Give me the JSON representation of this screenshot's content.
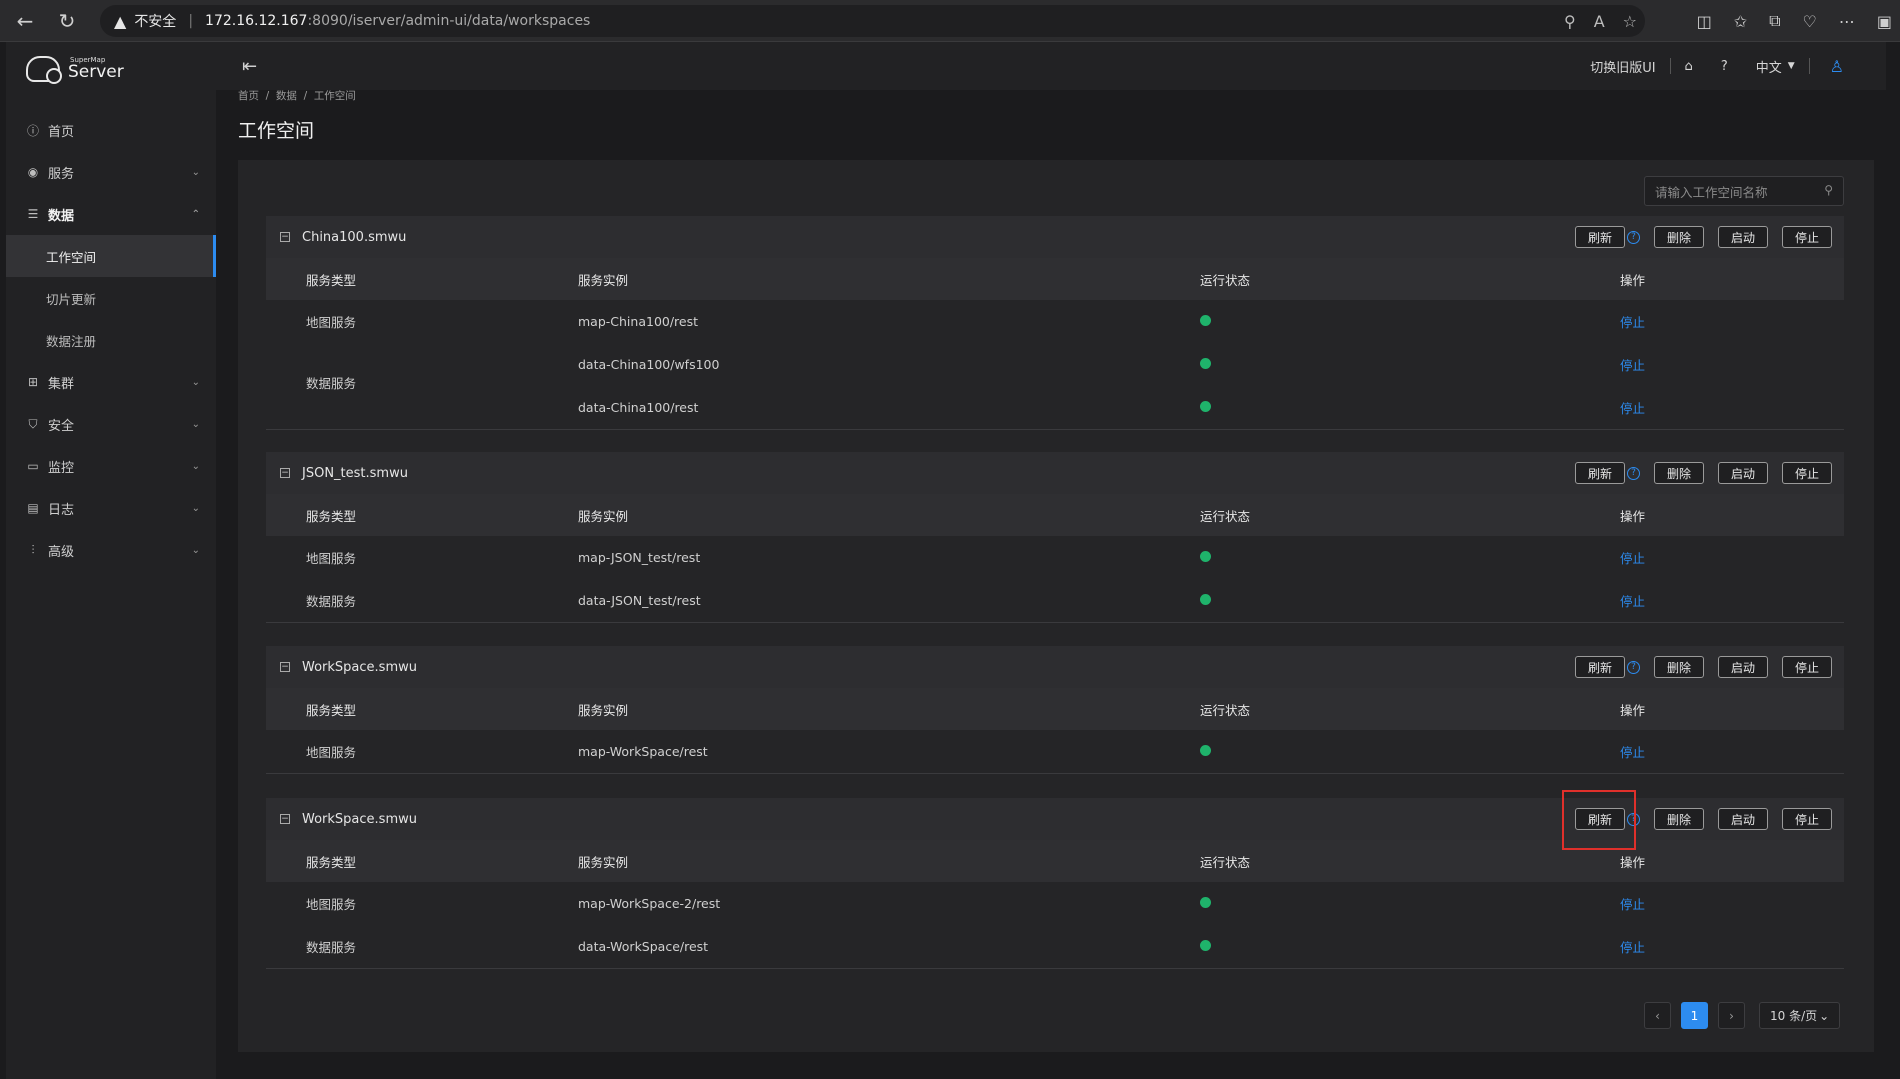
{
  "browser": {
    "not_secure": "不安全",
    "url_host": "172.16.12.167",
    "url_path": ":8090/iserver/admin-ui/data/workspaces"
  },
  "logo": {
    "small": "SuperMap",
    "big": "Server"
  },
  "sidebar": {
    "items": [
      {
        "label": "首页",
        "icon": "info-icon"
      },
      {
        "label": "服务",
        "icon": "eye-icon"
      },
      {
        "label": "数据",
        "icon": "database-icon"
      },
      {
        "label": "集群",
        "icon": "cluster-icon"
      },
      {
        "label": "安全",
        "icon": "shield-icon"
      },
      {
        "label": "监控",
        "icon": "monitor-icon"
      },
      {
        "label": "日志",
        "icon": "log-icon"
      },
      {
        "label": "高级",
        "icon": "sliders-icon"
      }
    ],
    "sub_items": [
      "工作空间",
      "切片更新",
      "数据注册"
    ]
  },
  "header": {
    "switch_ui": "切换旧版UI",
    "lang": "中文"
  },
  "breadcrumb": {
    "home": "首页",
    "data": "数据",
    "current": "工作空间"
  },
  "page_title": "工作空间",
  "search": {
    "placeholder": "请输入工作空间名称"
  },
  "buttons": {
    "refresh": "刷新",
    "delete": "删除",
    "start": "启动",
    "stop": "停止"
  },
  "table_headers": {
    "type": "服务类型",
    "instance": "服务实例",
    "status": "运行状态",
    "action": "操作"
  },
  "action_link": "停止",
  "workspaces": [
    {
      "name": "China100.smwu",
      "rows": [
        {
          "type": "地图服务",
          "instance": "map-China100/rest"
        },
        {
          "type": "数据服务",
          "instance": "data-China100/wfs100"
        },
        {
          "type": "",
          "instance": "data-China100/rest"
        }
      ]
    },
    {
      "name": "JSON_test.smwu",
      "rows": [
        {
          "type": "地图服务",
          "instance": "map-JSON_test/rest"
        },
        {
          "type": "数据服务",
          "instance": "data-JSON_test/rest"
        }
      ]
    },
    {
      "name": "WorkSpace.smwu",
      "rows": [
        {
          "type": "地图服务",
          "instance": "map-WorkSpace/rest"
        }
      ]
    },
    {
      "name": "WorkSpace.smwu",
      "rows": [
        {
          "type": "地图服务",
          "instance": "map-WorkSpace-2/rest"
        },
        {
          "type": "数据服务",
          "instance": "data-WorkSpace/rest"
        }
      ]
    }
  ],
  "pagination": {
    "current": "1",
    "page_size": "10 条/页"
  },
  "colors": {
    "accent": "#2d8cf0",
    "running": "#1fb36b",
    "highlight": "#e0302b"
  }
}
